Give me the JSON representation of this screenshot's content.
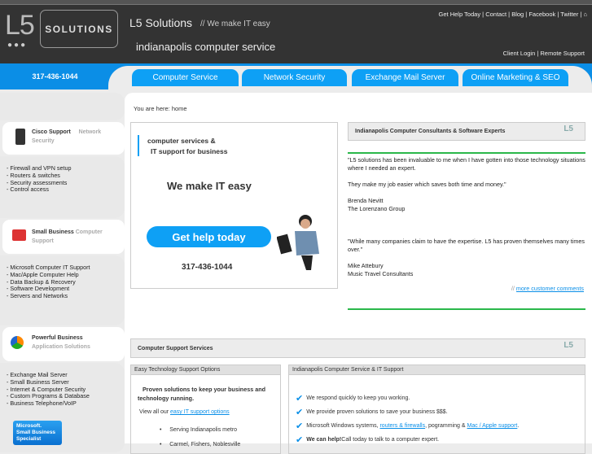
{
  "header": {
    "logo_mark": "L5",
    "logo_text": "SOLUTIONS",
    "brand": "L5 Solutions",
    "tagline": "// We make IT easy",
    "subtitle": "indianapolis computer service",
    "top_links": [
      "Get Help Today",
      "Contact",
      "Blog",
      "Facebook",
      "Twitter"
    ],
    "bottom_links": [
      "Client Login",
      "Remote Support"
    ]
  },
  "phone": "317-436-1044",
  "tabs": [
    "Computer Service",
    "Network Security",
    "Exchange Mail Server",
    "Online Marketing & SEO"
  ],
  "breadcrumb": "You are here: home",
  "sidebar": [
    {
      "title": "Cisco Support",
      "subtitle": "Network Security",
      "items": [
        "- Firewall and VPN setup",
        "- Routers & switches",
        "- Security assessments",
        "- Control access"
      ]
    },
    {
      "title": "Small Business",
      "subtitle": "Computer Support",
      "items": [
        "- Microsoft Computer IT Support",
        "- Mac/Apple Computer Help",
        "- Data Backup & Recovery",
        "- Software Development",
        "- Servers and Networks"
      ]
    },
    {
      "title": "Powerful Business",
      "subtitle": "Application Solutions",
      "items": [
        "- Exchange Mail Server",
        "- Small Business Server",
        "- Internet & Computer Security",
        "- Custom Programs & Database",
        "- Business Telephone/VoIP"
      ]
    }
  ],
  "badge": [
    "Microsoft.",
    "Small Business",
    "Specialist"
  ],
  "hero": {
    "line1": "computer services &",
    "line2": "IT support for business",
    "headline": "We make IT easy",
    "button": "Get help today",
    "phone": "317-436-1044"
  },
  "consultants": {
    "title": "Indianapolis Computer Consultants & Software Experts",
    "logo": "L5",
    "quote1": "\"L5 solutions has been invaluable to me when I have gotten into those technology situations where I needed an expert.",
    "quote1b": "They make my job easier which saves both time and money.\"",
    "name1": "Brenda Nevitt",
    "org1": "The Lorenzano Group",
    "quote2": "\"While many companies claim to have the expertise. L5 has proven themselves many times over.\"",
    "name2": "Mike Attebury",
    "org2": "Music Travel Consultants",
    "more_prefix": "//",
    "more_link": "more customer comments"
  },
  "services": {
    "title": "Computer Support Services",
    "logo": "L5",
    "left": {
      "title": "Easy Technology Support Options",
      "intro": "Proven solutions to keep your business and technology running.",
      "view_prefix": "View all our",
      "view_link": "easy IT support options",
      "bullets": [
        "Serving Indianapolis metro",
        "Carmel, Fishers, Noblesville"
      ]
    },
    "right": {
      "title": "Indianapolis Computer Service & IT Support",
      "r1": "We respond quickly to keep you working.",
      "r2": "We provide proven solutions to save your business $$$.",
      "r3a": "Microsoft Windows systems,",
      "r3l1": "routers & firewalls",
      "r3b": ", pogramming &",
      "r3l2": "Mac / Apple support",
      "r3c": ".",
      "r4b": "We can help!",
      "r4": " Call today to talk to a computer expert."
    }
  }
}
